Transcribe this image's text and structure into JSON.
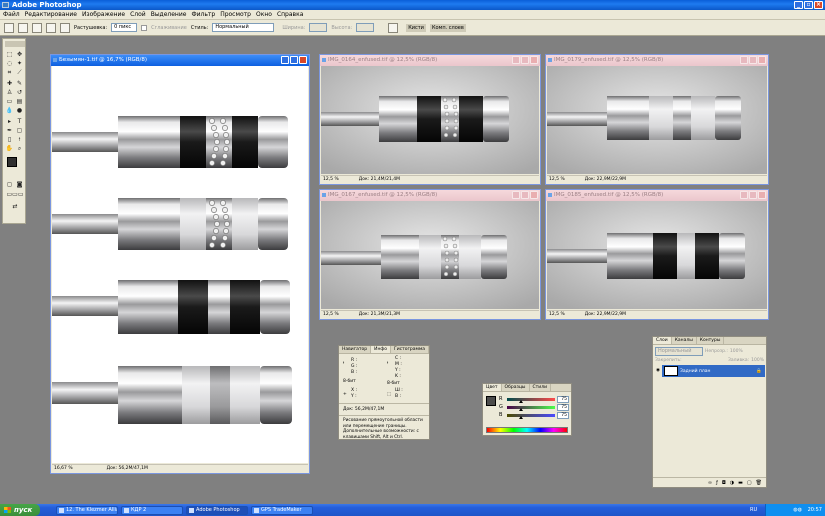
{
  "app": {
    "title": "Adobe Photoshop"
  },
  "menu": [
    "Файл",
    "Редактирование",
    "Изображение",
    "Слой",
    "Выделение",
    "Фильтр",
    "Просмотр",
    "Окно",
    "Справка"
  ],
  "options": {
    "feather_label": "Растушевка:",
    "feather_value": "0 пикс",
    "antialias_label": "Сглаживание",
    "style_label": "Стиль:",
    "style_value": "Нормальный",
    "width_label": "Ширина:",
    "height_label": "Высота:",
    "palette_tabs": [
      "Кисти",
      "Комп. слоев"
    ]
  },
  "docs": [
    {
      "title": "Безымян-1.tif @ 16,7% (RGB/8)",
      "zoom": "16,67 %",
      "doc": "Док: 56,2M/47,1M",
      "active": true
    },
    {
      "title": "IMG_0164_enfused.tif @ 12,5% (RGB/8)",
      "zoom": "12,5 %",
      "doc": "Док: 21,4M/21,4M",
      "active": false
    },
    {
      "title": "IMG_0179_enfused.tif @ 12,5% (RGB/8)",
      "zoom": "12,5 %",
      "doc": "Док: 22,9M/22,9M",
      "active": false
    },
    {
      "title": "IMG_0167_enfused.tif @ 12,5% (RGB/8)",
      "zoom": "12,5 %",
      "doc": "Док: 21,3M/21,3M",
      "active": false
    },
    {
      "title": "IMG_0185_enfused.tif @ 12,5% (RGB/8)",
      "zoom": "12,5 %",
      "doc": "Док: 22,9M/22,9M",
      "active": false
    }
  ],
  "info_panel": {
    "tabs": [
      "Навигатор",
      "Инфо",
      "Гистограмма"
    ],
    "r": "R :",
    "g": "G :",
    "b": "B :",
    "c": "C :",
    "m": "M :",
    "y": "Y :",
    "k": "K :",
    "bit1": "8-бит",
    "bit2": "8-бит",
    "x": "X :",
    "y2": "Y :",
    "w": "Ш :",
    "h": "В :",
    "doc": "Док: 56,2M/47,1M",
    "hint": "Рисование прямоугольной области или перемещение границы. Дополнительные возможности: с клавишами Shift, Alt и Ctrl."
  },
  "color_panel": {
    "tabs": [
      "Цвет",
      "Образцы",
      "Стили"
    ],
    "r_label": "R",
    "g_label": "G",
    "b_label": "B",
    "r_value": "75",
    "g_value": "75",
    "b_value": "75",
    "r_level": 0.294,
    "g_level": 0.294,
    "b_level": 0.294
  },
  "layers_panel": {
    "tabs": [
      "Слои",
      "Каналы",
      "Контуры"
    ],
    "blend_mode": "Нормальный",
    "opacity_label": "Непрозр.:",
    "opacity_value": "100%",
    "lock_label": "Закрепить:",
    "fill_label": "Заливка:",
    "fill_value": "100%",
    "layer_name": "Задний план"
  },
  "taskbar": {
    "start": "пуск",
    "tasks": [
      "12. The Klezmer Allia...",
      "КДР 2",
      "Adobe Photoshop",
      "GPS TradeMaker"
    ],
    "lang": "RU",
    "time": "20:57"
  },
  "colors": {
    "accent": "#0d5fe0",
    "workspace": "#808080",
    "panel": "#ece9d8"
  }
}
